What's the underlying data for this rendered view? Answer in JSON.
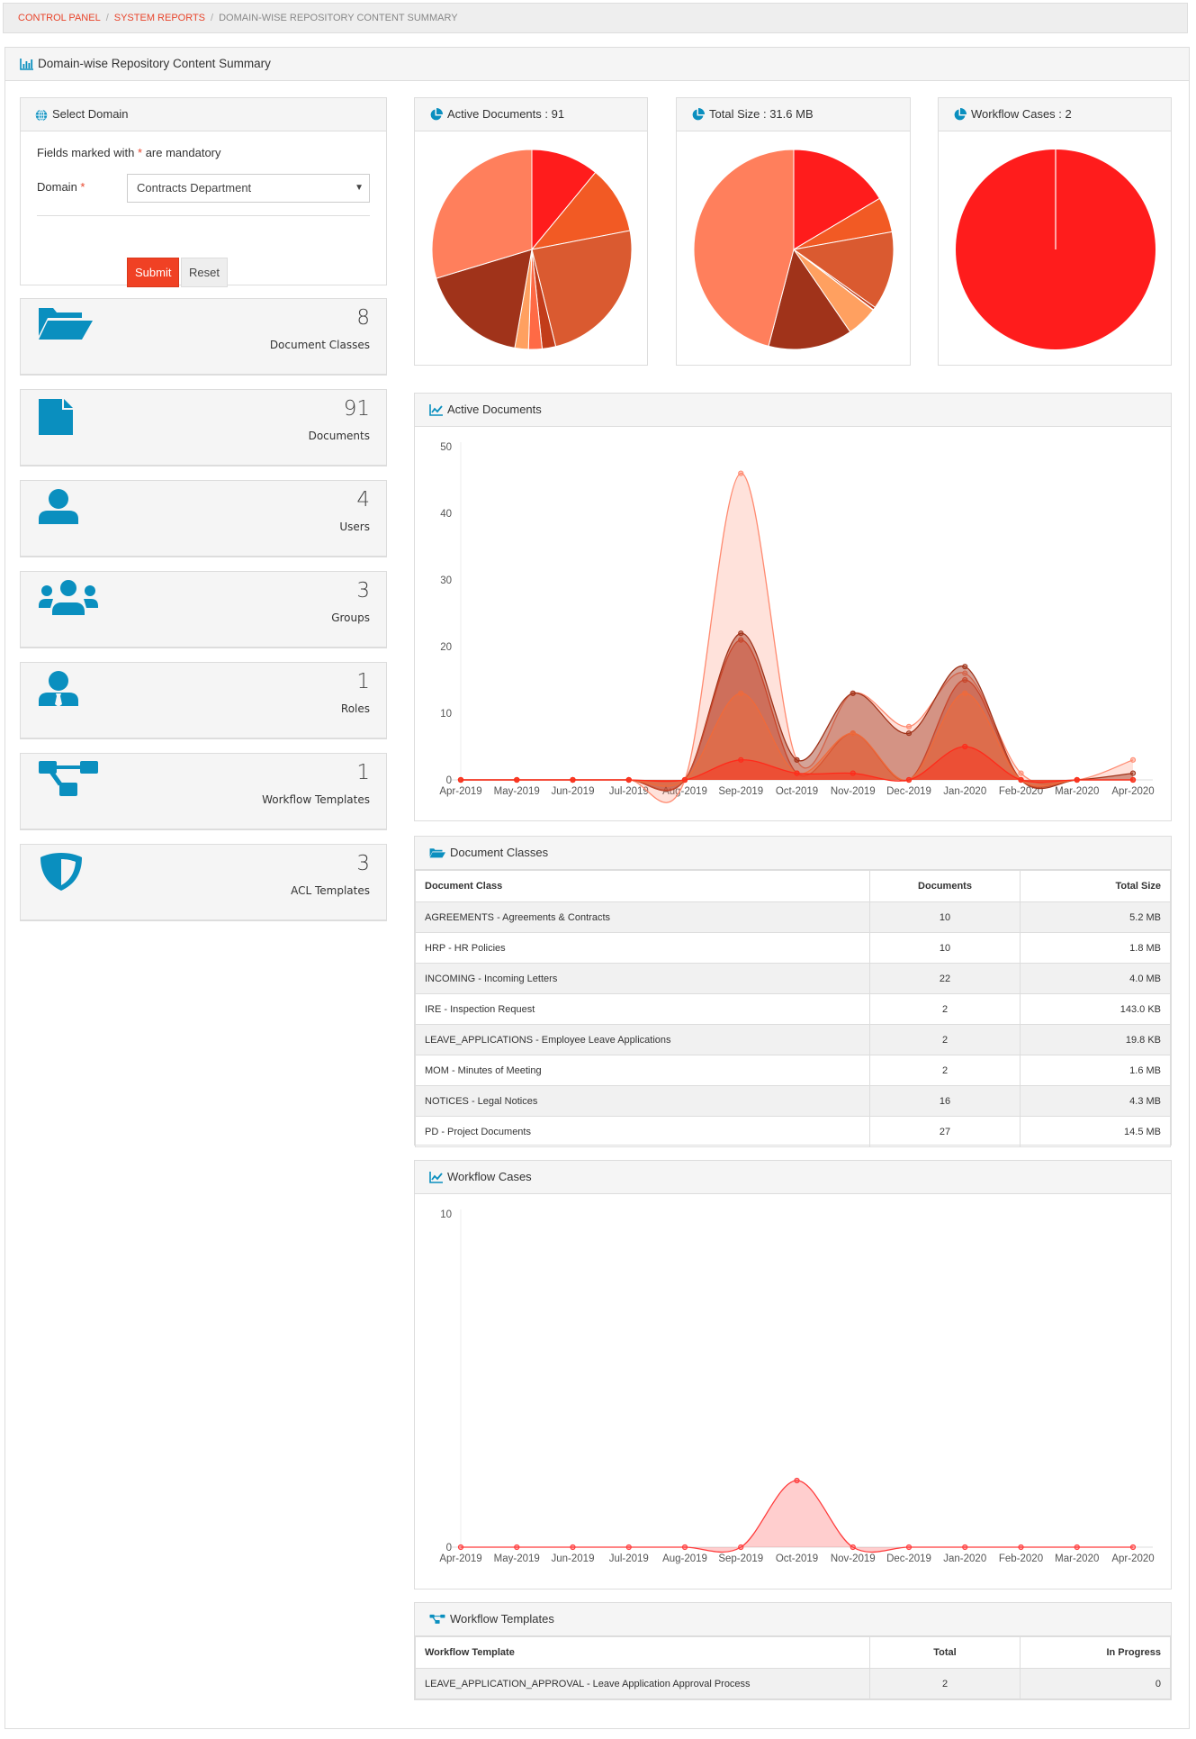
{
  "breadcrumb": {
    "items": [
      "Control Panel",
      "System Reports"
    ],
    "current": "Domain-wise Repository Content Summary"
  },
  "page": {
    "title": "Domain-wise Repository Content Summary"
  },
  "colors": {
    "accent": "#0a8fbf",
    "primary_button": "#f04124",
    "slices": [
      "#ff1c1c",
      "#f25a24",
      "#da5a30",
      "#c23c1a",
      "#ff6a45",
      "#ffa060",
      "#a0331a",
      "#ff7f5c"
    ]
  },
  "select_domain": {
    "title": "Select Domain",
    "mandatory_prefix": "Fields marked with",
    "mandatory_star": "*",
    "mandatory_suffix": "are mandatory",
    "domain_label": "Domain",
    "domain_value": "Contracts Department",
    "submit": "Submit",
    "reset": "Reset"
  },
  "stats": [
    {
      "icon": "folder-open-icon",
      "value": "8",
      "label": "Document Classes"
    },
    {
      "icon": "file-icon",
      "value": "91",
      "label": "Documents"
    },
    {
      "icon": "user-icon",
      "value": "4",
      "label": "Users"
    },
    {
      "icon": "users-icon",
      "value": "3",
      "label": "Groups"
    },
    {
      "icon": "user-tie-icon",
      "value": "1",
      "label": "Roles"
    },
    {
      "icon": "sitemap-icon",
      "value": "1",
      "label": "Workflow Templates"
    },
    {
      "icon": "shield-icon",
      "value": "3",
      "label": "ACL Templates"
    }
  ],
  "chart_data": [
    {
      "type": "pie",
      "title": "Active Documents : 91",
      "categories": [
        "AGREEMENTS",
        "HRP",
        "INCOMING",
        "IRE",
        "LEAVE_APPLICATIONS",
        "MOM",
        "NOTICES",
        "PD"
      ],
      "values": [
        10,
        10,
        22,
        2,
        2,
        2,
        16,
        27
      ]
    },
    {
      "type": "pie",
      "title": "Total Size : 31.6 MB",
      "categories": [
        "AGREEMENTS",
        "HRP",
        "INCOMING",
        "IRE",
        "LEAVE_APPLICATIONS",
        "MOM",
        "NOTICES",
        "PD"
      ],
      "values": [
        5.2,
        1.8,
        4.0,
        0.143,
        0.0198,
        1.6,
        4.3,
        14.5
      ]
    },
    {
      "type": "pie",
      "title": "Workflow Cases : 2",
      "categories": [
        "LEAVE_APPLICATION_APPROVAL"
      ],
      "values": [
        2
      ]
    },
    {
      "type": "area",
      "title": "Active Documents",
      "categories": [
        "Apr-2019",
        "May-2019",
        "Jun-2019",
        "Jul-2019",
        "Aug-2019",
        "Sep-2019",
        "Oct-2019",
        "Nov-2019",
        "Dec-2019",
        "Jan-2020",
        "Feb-2020",
        "Mar-2020",
        "Apr-2020"
      ],
      "ylim": [
        0,
        50
      ],
      "yticks": [
        0,
        10,
        20,
        30,
        40,
        50
      ],
      "grid": false,
      "series": [
        {
          "color": "#ff8a70",
          "values": [
            0,
            0,
            0,
            0,
            0,
            46,
            3,
            13,
            8,
            16,
            1,
            0,
            3
          ]
        },
        {
          "color": "#a0331a",
          "values": [
            0,
            0,
            0,
            0,
            0,
            22,
            3,
            13,
            7,
            17,
            0,
            0,
            1
          ]
        },
        {
          "color": "#c8452a",
          "values": [
            0,
            0,
            0,
            0,
            0,
            21,
            1,
            7,
            0,
            15,
            0,
            0,
            0
          ]
        },
        {
          "color": "#f06a3a",
          "values": [
            0,
            0,
            0,
            0,
            0,
            13,
            1,
            7,
            0,
            13,
            0,
            0,
            0
          ]
        },
        {
          "color": "#ff2a1a",
          "values": [
            0,
            0,
            0,
            0,
            0,
            3,
            1,
            1,
            0,
            5,
            0,
            0,
            0
          ]
        }
      ]
    },
    {
      "type": "area",
      "title": "Workflow Cases",
      "categories": [
        "Apr-2019",
        "May-2019",
        "Jun-2019",
        "Jul-2019",
        "Aug-2019",
        "Sep-2019",
        "Oct-2019",
        "Nov-2019",
        "Dec-2019",
        "Jan-2020",
        "Feb-2020",
        "Mar-2020",
        "Apr-2020"
      ],
      "ylim": [
        0,
        10
      ],
      "yticks": [
        0,
        10
      ],
      "grid": false,
      "series": [
        {
          "color": "#ff3b3b",
          "values": [
            0,
            0,
            0,
            0,
            0,
            0,
            2,
            0,
            0,
            0,
            0,
            0,
            0
          ]
        }
      ]
    }
  ],
  "doc_classes": {
    "title": "Document Classes",
    "headers": [
      "Document Class",
      "Documents",
      "Total Size"
    ],
    "rows": [
      [
        "AGREEMENTS - Agreements & Contracts",
        "10",
        "5.2 MB"
      ],
      [
        "HRP - HR Policies",
        "10",
        "1.8 MB"
      ],
      [
        "INCOMING - Incoming Letters",
        "22",
        "4.0 MB"
      ],
      [
        "IRE - Inspection Request",
        "2",
        "143.0 KB"
      ],
      [
        "LEAVE_APPLICATIONS - Employee Leave Applications",
        "2",
        "19.8 KB"
      ],
      [
        "MOM - Minutes of Meeting",
        "2",
        "1.6 MB"
      ],
      [
        "NOTICES - Legal Notices",
        "16",
        "4.3 MB"
      ],
      [
        "PD - Project Documents",
        "27",
        "14.5 MB"
      ]
    ]
  },
  "workflow_templates": {
    "title": "Workflow Templates",
    "headers": [
      "Workflow Template",
      "Total",
      "In Progress"
    ],
    "rows": [
      [
        "LEAVE_APPLICATION_APPROVAL - Leave Application Approval Process",
        "2",
        "0"
      ]
    ]
  }
}
